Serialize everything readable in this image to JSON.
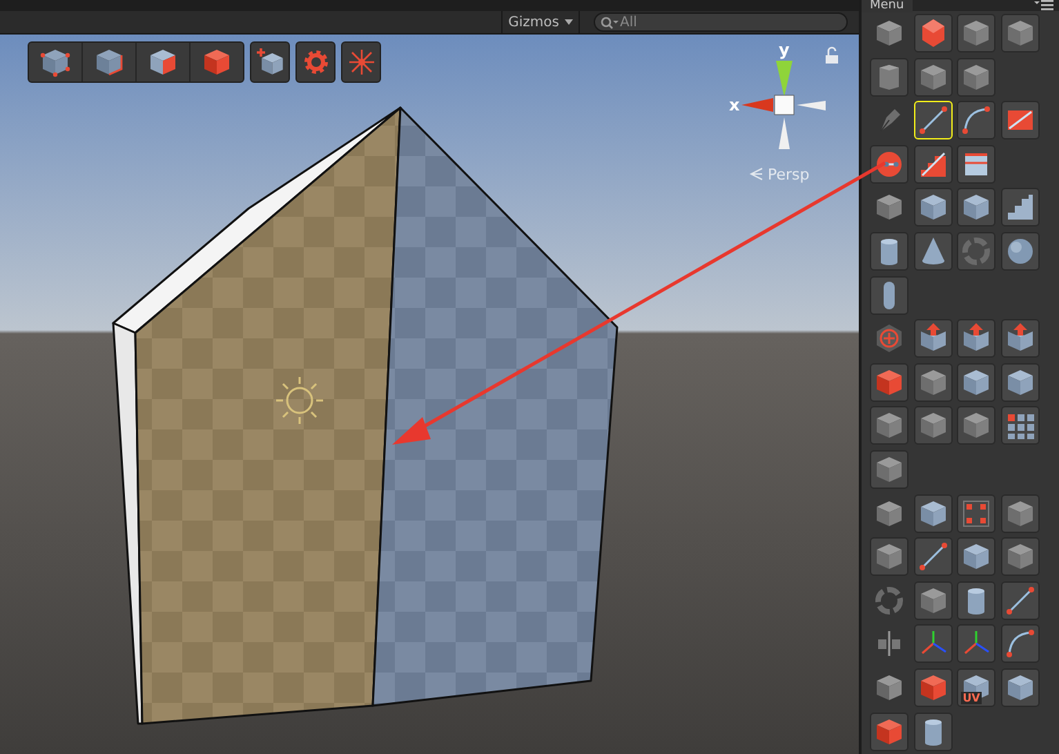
{
  "toolbar": {
    "gizmos": "Gizmos",
    "search": {
      "placeholder": "All"
    }
  },
  "gizmo": {
    "x_label": "x",
    "y_label": "y",
    "projection": "Persp"
  },
  "panel": {
    "tab": "Menu",
    "rows": [
      [
        {
          "kind": "plain",
          "selected": false
        },
        {
          "kind": "button",
          "selected": false
        },
        {
          "kind": "button",
          "selected": false
        },
        {
          "kind": "button",
          "selected": false
        }
      ],
      [
        {
          "kind": "button",
          "selected": false
        },
        {
          "kind": "button",
          "selected": false
        },
        {
          "kind": "button",
          "selected": false
        }
      ],
      [
        {
          "kind": "plain",
          "selected": false
        },
        {
          "kind": "button",
          "selected": true
        },
        {
          "kind": "button",
          "selected": false
        },
        {
          "kind": "button",
          "selected": false
        }
      ],
      [
        {
          "kind": "button",
          "selected": false
        },
        {
          "kind": "button",
          "selected": false
        },
        {
          "kind": "button",
          "selected": false
        }
      ],
      [
        {
          "kind": "plain",
          "selected": false
        },
        {
          "kind": "button",
          "selected": false
        },
        {
          "kind": "button",
          "selected": false
        },
        {
          "kind": "button",
          "selected": false
        }
      ],
      [
        {
          "kind": "button",
          "selected": false
        },
        {
          "kind": "button",
          "selected": false
        },
        {
          "kind": "button",
          "selected": false
        },
        {
          "kind": "button",
          "selected": false
        }
      ],
      [
        {
          "kind": "button",
          "selected": false
        }
      ],
      [
        {
          "kind": "plain",
          "selected": false
        },
        {
          "kind": "button",
          "selected": false
        },
        {
          "kind": "button",
          "selected": false
        },
        {
          "kind": "button",
          "selected": false
        }
      ],
      [
        {
          "kind": "button",
          "selected": false
        },
        {
          "kind": "button",
          "selected": false
        },
        {
          "kind": "button",
          "selected": false
        },
        {
          "kind": "button",
          "selected": false
        }
      ],
      [
        {
          "kind": "button",
          "selected": false
        },
        {
          "kind": "button",
          "selected": false
        },
        {
          "kind": "button",
          "selected": false
        },
        {
          "kind": "button",
          "selected": false
        }
      ],
      [
        {
          "kind": "button",
          "selected": false
        }
      ],
      [
        {
          "kind": "plain",
          "selected": false
        },
        {
          "kind": "button",
          "selected": false
        },
        {
          "kind": "button",
          "selected": false
        },
        {
          "kind": "button",
          "selected": false
        }
      ],
      [
        {
          "kind": "button",
          "selected": false
        },
        {
          "kind": "button",
          "selected": false
        },
        {
          "kind": "button",
          "selected": false
        },
        {
          "kind": "button",
          "selected": false
        }
      ],
      [
        {
          "kind": "plain",
          "selected": false
        },
        {
          "kind": "button",
          "selected": false
        },
        {
          "kind": "button",
          "selected": false
        },
        {
          "kind": "button",
          "selected": false
        }
      ],
      [
        {
          "kind": "plain",
          "selected": false
        },
        {
          "kind": "button",
          "selected": false
        },
        {
          "kind": "button",
          "selected": false
        },
        {
          "kind": "button",
          "selected": false
        }
      ],
      [
        {
          "kind": "plain",
          "selected": false
        },
        {
          "kind": "button",
          "selected": false
        },
        {
          "kind": "button",
          "selected": false,
          "label": "UV"
        },
        {
          "kind": "button",
          "selected": false
        }
      ],
      [
        {
          "kind": "button",
          "selected": false
        },
        {
          "kind": "button",
          "selected": false
        }
      ]
    ]
  }
}
